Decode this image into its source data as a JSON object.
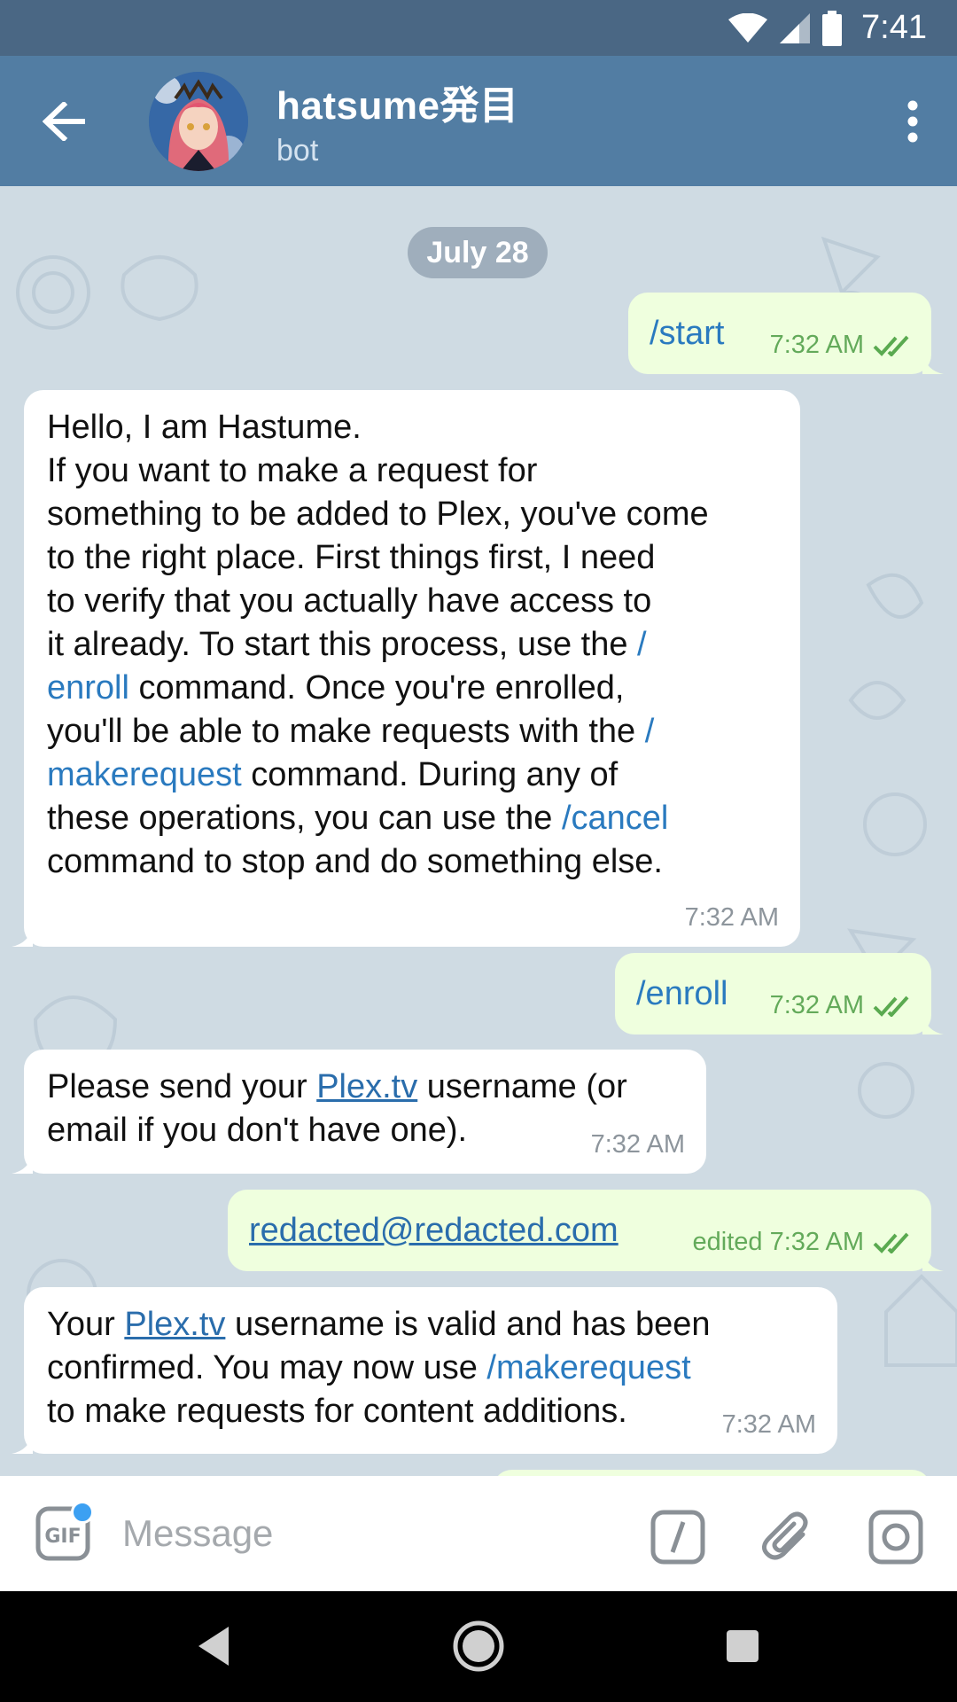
{
  "status_bar": {
    "time": "7:41"
  },
  "header": {
    "title": "hatsume発目",
    "subtitle": "bot"
  },
  "date_pill": "July 28",
  "messages": [
    {
      "dir": "out",
      "text": "/start",
      "time": "7:32 AM"
    },
    {
      "dir": "in",
      "lines": [
        "Hello, I am Hastume.",
        "If you want to make a request for",
        "something to be added to Plex, you've come",
        "to the right place. First things first, I need",
        "to verify that you actually have access to",
        "it already. To start this process, use the ",
        "/",
        "enroll",
        " command. Once you're enrolled,",
        "you'll be able to make requests with the ",
        "/",
        "makerequest",
        " command. During any of",
        "these operations, you can use the ",
        "/cancel",
        "command to stop and do something else."
      ],
      "time": "7:32 AM"
    },
    {
      "dir": "out",
      "text": "/enroll",
      "time": "7:32 AM"
    },
    {
      "dir": "in",
      "pre": "Please send your ",
      "link": "Plex.tv",
      "post": " username (or",
      "line2": "email if you don't have one).",
      "time": "7:32 AM"
    },
    {
      "dir": "out",
      "text": "redacted@redacted.com",
      "time": "edited 7:32 AM"
    },
    {
      "dir": "in",
      "pre": "Your ",
      "link": "Plex.tv",
      "post": " username is valid and has been",
      "line2_pre": "confirmed. You may now use ",
      "line2_cmd": "/makerequest",
      "line3": "to make requests for content additions.",
      "time": "7:32 AM"
    }
  ],
  "input": {
    "placeholder": "Message"
  },
  "icons": {
    "back": "arrow-left-icon",
    "menu": "more-vert-icon",
    "gif": "gif-icon",
    "command": "slash-command-icon",
    "attach": "paperclip-icon",
    "camera": "camera-icon",
    "nav_back": "triangle-back-icon",
    "nav_home": "circle-home-icon",
    "nav_recent": "square-recent-icon"
  },
  "colors": {
    "header": "#527da3",
    "status_bar": "#4a6784",
    "chat_bg": "#cfdbe3",
    "out_bubble": "#efffde",
    "link": "#2a7abf"
  }
}
